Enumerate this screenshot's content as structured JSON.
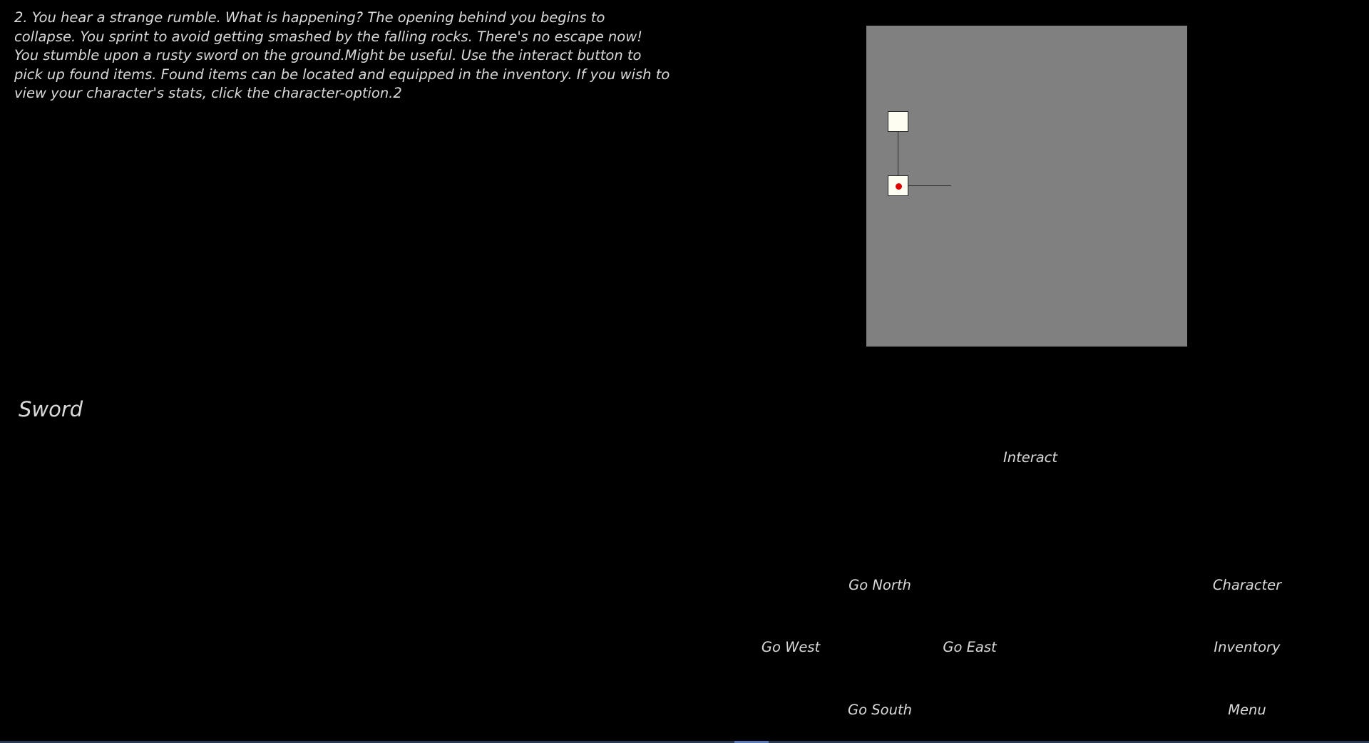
{
  "story": {
    "text": "2. You hear a strange rumble. What is happening? The opening behind you begins to collapse. You sprint to avoid getting smashed by the falling rocks. There's no escape now! You stumble upon a rusty sword on the ground.Might be useful. Use the interact button to pick up found items. Found items can be located and equipped in the inventory. If you wish to view your character's stats, click the character-option.2"
  },
  "found_item": {
    "name": "Sword"
  },
  "map": {
    "background_color": "#808080",
    "room_color": "#fdfdf2",
    "player_marker_color": "#e00000",
    "rooms": [
      {
        "id": "north-room",
        "visited": true,
        "current": false
      },
      {
        "id": "current-room",
        "visited": true,
        "current": true
      }
    ],
    "passages": [
      "north",
      "east"
    ]
  },
  "actions": {
    "interact": "Interact",
    "go_north": "Go North",
    "go_west": "Go West",
    "go_east": "Go East",
    "go_south": "Go South",
    "character": "Character",
    "inventory": "Inventory",
    "menu": "Menu"
  },
  "colors": {
    "background": "#000000",
    "text": "#d9d9d9"
  }
}
